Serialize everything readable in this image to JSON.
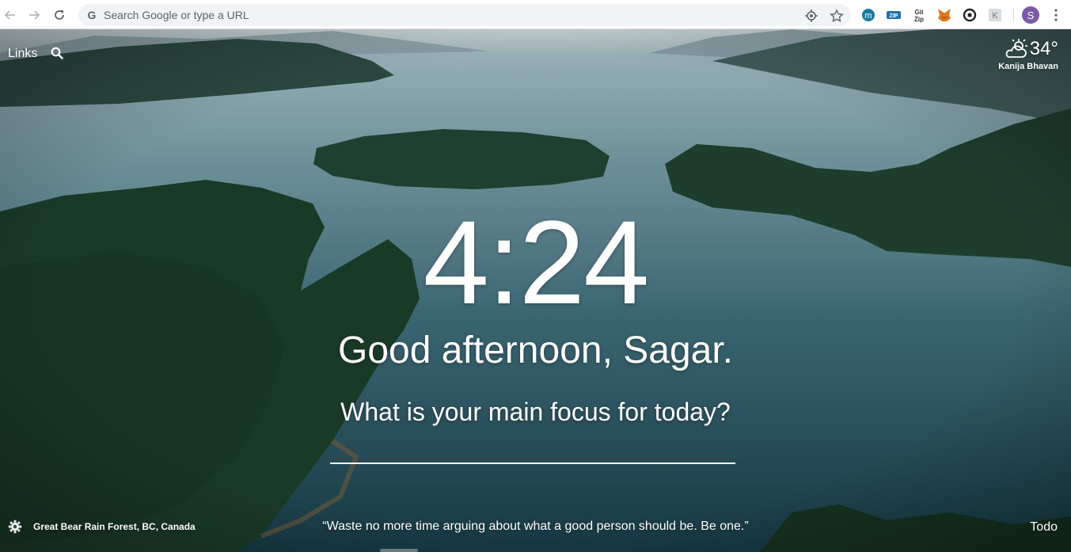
{
  "browser": {
    "omnibox_placeholder": "Search Google or type a URL",
    "profile_initial": "S",
    "extensions": [
      "m-extension-icon",
      "zip-extension-icon",
      "gitzip-extension-icon",
      "metamask-fox-icon",
      "link-extension-icon",
      "k-extension-icon"
    ]
  },
  "header": {
    "links_label": "Links"
  },
  "weather": {
    "temperature": "34°",
    "location": "Kanija Bhavan",
    "condition_icon": "partly-cloudy-sun-icon"
  },
  "main": {
    "time": "4:24",
    "greeting": "Good afternoon, Sagar.",
    "focus_prompt": "What is your main focus for today?",
    "focus_value": ""
  },
  "footer": {
    "photo_location": "Great Bear Rain Forest, BC, Canada",
    "quote": "“Waste no more time arguing about what a good person should be. Be one.”",
    "todo_label": "Todo"
  },
  "colors": {
    "text": "#ffffff",
    "water": "#2f5a68",
    "forest": "#1f3d2c",
    "toolbar": "#ffffff",
    "omnibox": "#f1f3f4"
  }
}
